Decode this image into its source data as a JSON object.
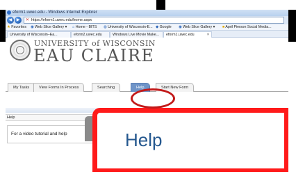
{
  "browser": {
    "window_title": "eform1.uwec.edu - Windows Internet Explorer",
    "address": "https://eform1.uwec.edu/home.aspx",
    "favorites": [
      "Favorites",
      "Web Slice Gallery ▾",
      "Home - BITS",
      "University of Wisconsin-E...",
      "Google",
      "Web Slice Gallery ▾",
      "April Pierson Social Media..."
    ],
    "tabs": [
      "University of Wisconsin–Ea...",
      "eform2.uwec.edu",
      "Windows Live Movie Make...",
      "eform1.uwec.edu"
    ],
    "tab_close": "×"
  },
  "site": {
    "university": "UNIVERSITY of WISCONSIN",
    "campus": "EAU CLAIRE"
  },
  "nav_tabs": [
    "My Tasks",
    "View Forms In Process",
    "Searching",
    "Help",
    "Start New Form"
  ],
  "help": {
    "header": "Help",
    "body_text": "For a video tutorial and help",
    "callout_label": "Help"
  },
  "colors": {
    "active_tab": "#6f94c8",
    "callout_border": "#ff1a1a",
    "ellipse": "#c21a1a",
    "callout_text": "#25588f"
  }
}
